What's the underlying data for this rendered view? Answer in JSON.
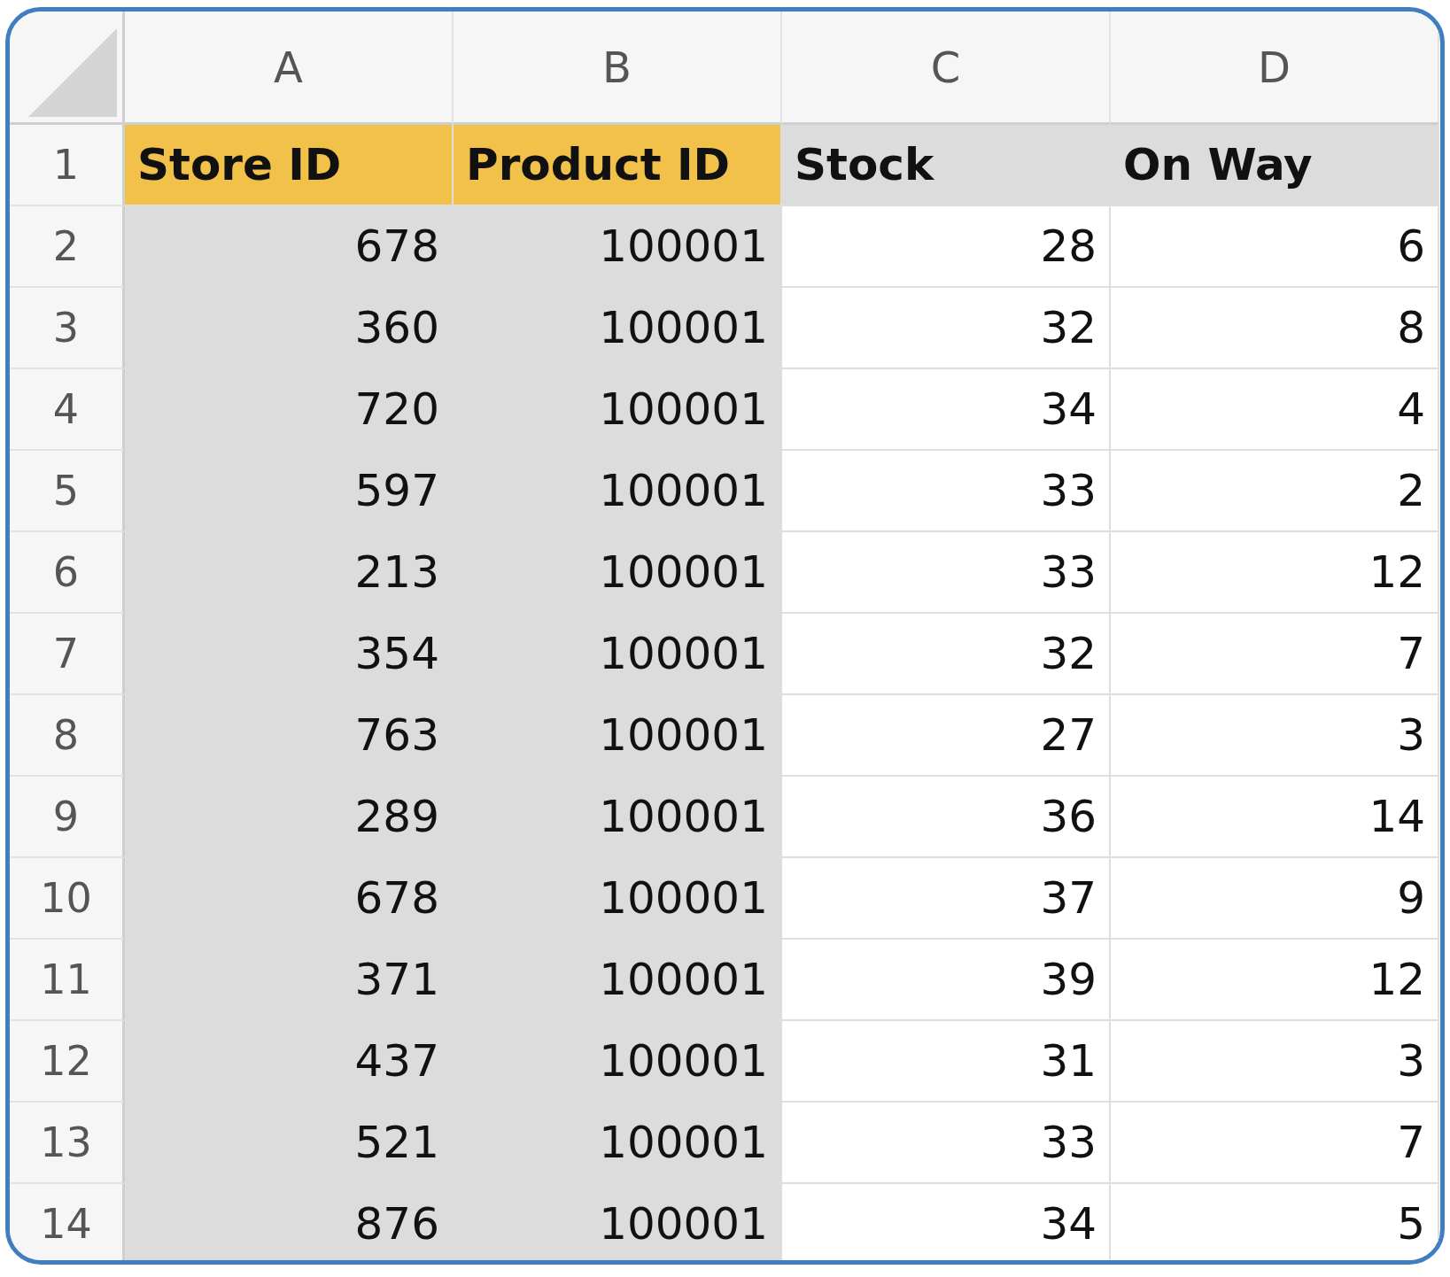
{
  "columns": [
    {
      "letter": "A",
      "color": "#f2c14a",
      "shaded": true
    },
    {
      "letter": "B",
      "color": "#f2c14a",
      "shaded": true
    },
    {
      "letter": "C",
      "color": "#dcdcdc",
      "shaded": false
    },
    {
      "letter": "D",
      "color": "#dcdcdc",
      "shaded": false
    }
  ],
  "rows": [
    {
      "number": "1",
      "cells": [
        "Store ID",
        "Product ID",
        "Stock",
        "On Way"
      ]
    },
    {
      "number": "2",
      "cells": [
        "678",
        "100001",
        "28",
        "6"
      ]
    },
    {
      "number": "3",
      "cells": [
        "360",
        "100001",
        "32",
        "8"
      ]
    },
    {
      "number": "4",
      "cells": [
        "720",
        "100001",
        "34",
        "4"
      ]
    },
    {
      "number": "5",
      "cells": [
        "597",
        "100001",
        "33",
        "2"
      ]
    },
    {
      "number": "6",
      "cells": [
        "213",
        "100001",
        "33",
        "12"
      ]
    },
    {
      "number": "7",
      "cells": [
        "354",
        "100001",
        "32",
        "7"
      ]
    },
    {
      "number": "8",
      "cells": [
        "763",
        "100001",
        "27",
        "3"
      ]
    },
    {
      "number": "9",
      "cells": [
        "289",
        "100001",
        "36",
        "14"
      ]
    },
    {
      "number": "10",
      "cells": [
        "678",
        "100001",
        "37",
        "9"
      ]
    },
    {
      "number": "11",
      "cells": [
        "371",
        "100001",
        "39",
        "12"
      ]
    },
    {
      "number": "12",
      "cells": [
        "437",
        "100001",
        "31",
        "3"
      ]
    },
    {
      "number": "13",
      "cells": [
        "521",
        "100001",
        "33",
        "7"
      ]
    },
    {
      "number": "14",
      "cells": [
        "876",
        "100001",
        "34",
        "5"
      ]
    }
  ]
}
